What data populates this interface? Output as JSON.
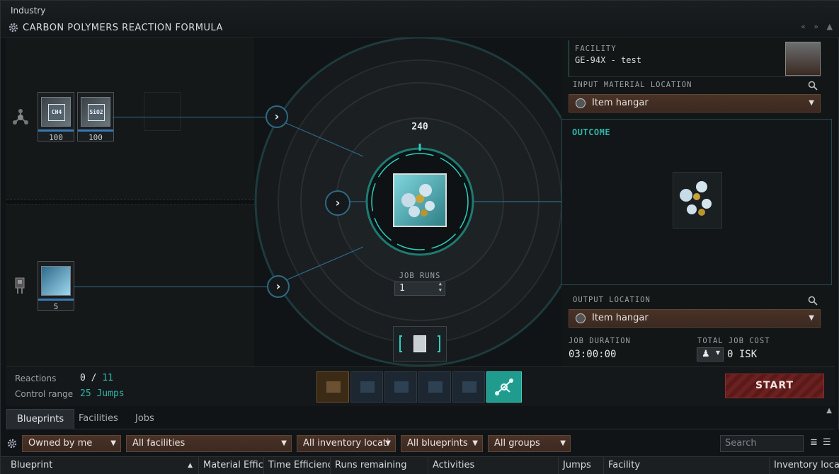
{
  "window": {
    "app_title": "Industry",
    "formula_title": "CARBON POLYMERS REACTION FORMULA",
    "controls": [
      "«",
      "»",
      "▲"
    ]
  },
  "inputs": {
    "materials": [
      {
        "symbol": "CH4",
        "quantity": "100"
      },
      {
        "symbol": "SiO2",
        "quantity": "100"
      }
    ],
    "fuel": {
      "quantity": "5"
    }
  },
  "reaction": {
    "output_quantity": "240",
    "job_runs_label": "JOB RUNS",
    "job_runs_value": "1"
  },
  "facility": {
    "label": "FACILITY",
    "name": "GE-94X - test"
  },
  "input_location": {
    "label": "INPUT MATERIAL LOCATION",
    "value": "Item hangar"
  },
  "outcome": {
    "label": "OUTCOME"
  },
  "output_location": {
    "label": "OUTPUT LOCATION",
    "value": "Item hangar"
  },
  "job": {
    "duration_label": "JOB DURATION",
    "duration": "03:00:00",
    "cost_label": "TOTAL JOB COST",
    "cost": "0 ISK"
  },
  "status": {
    "reactions_label": "Reactions",
    "reactions_used": "0",
    "reactions_sep": "/",
    "reactions_max": "11",
    "range_label": "Control range",
    "range_value": "25 Jumps"
  },
  "start_label": "START",
  "tabs": [
    "Blueprints",
    "Facilities",
    "Jobs"
  ],
  "filters": {
    "owner": "Owned by me",
    "facilities": "All facilities",
    "inventory": "All inventory locati",
    "blueprints": "All blueprints",
    "groups": "All groups",
    "search_placeholder": "Search"
  },
  "columns": [
    "Blueprint",
    "Material Effici",
    "Time Efficienc",
    "Runs remaining",
    "Activities",
    "Jumps",
    "Facility",
    "Inventory loca"
  ],
  "colors": {
    "accent": "#2fb5a8",
    "start": "#6b2120",
    "dropdown": "#4a3226",
    "line": "#2f6a8c"
  }
}
